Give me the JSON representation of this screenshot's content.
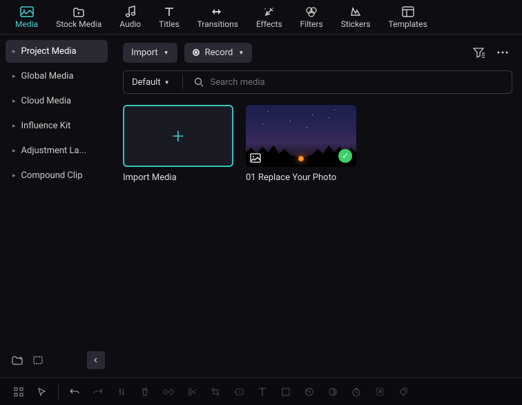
{
  "tabs": [
    {
      "label": "Media",
      "icon": "media",
      "active": true
    },
    {
      "label": "Stock Media",
      "icon": "stock"
    },
    {
      "label": "Audio",
      "icon": "audio"
    },
    {
      "label": "Titles",
      "icon": "titles"
    },
    {
      "label": "Transitions",
      "icon": "transitions"
    },
    {
      "label": "Effects",
      "icon": "effects"
    },
    {
      "label": "Filters",
      "icon": "filters"
    },
    {
      "label": "Stickers",
      "icon": "stickers"
    },
    {
      "label": "Templates",
      "icon": "templates"
    }
  ],
  "sidebar": {
    "items": [
      {
        "label": "Project Media",
        "active": true
      },
      {
        "label": "Global Media"
      },
      {
        "label": "Cloud Media"
      },
      {
        "label": "Influence Kit"
      },
      {
        "label": "Adjustment La..."
      },
      {
        "label": "Compound Clip"
      }
    ]
  },
  "toolbar": {
    "import_label": "Import",
    "record_label": "Record"
  },
  "search": {
    "default_label": "Default",
    "placeholder": "Search media"
  },
  "cards": [
    {
      "label": "Import Media",
      "kind": "import"
    },
    {
      "label": "01 Replace Your Photo",
      "kind": "photo"
    }
  ],
  "bottom_tools": {
    "grid": "grid-icon",
    "cursor": "cursor-icon",
    "undo": "undo-icon",
    "redo": "redo-icon",
    "marker": "marker-icon",
    "delete": "delete-icon",
    "link": "link-icon",
    "scissors": "scissors-icon",
    "crop": "crop-icon",
    "speed": "speed-icon",
    "text": "text-icon",
    "square": "square-icon",
    "history": "history-icon",
    "color": "color-icon",
    "timer": "timer-icon",
    "scale": "scale-icon",
    "tag": "tag-icon"
  }
}
